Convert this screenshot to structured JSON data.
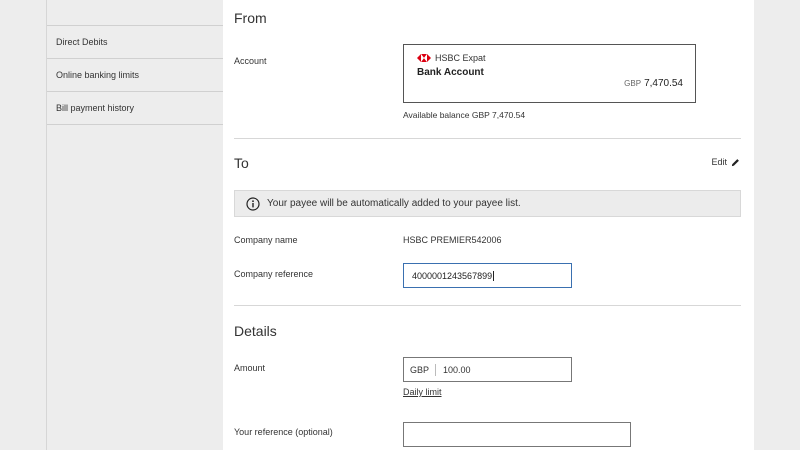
{
  "sidebar": {
    "items": [
      {
        "label": "Direct Debits"
      },
      {
        "label": "Online banking limits"
      },
      {
        "label": "Bill payment history"
      }
    ]
  },
  "from": {
    "title": "From",
    "account_label": "Account",
    "card": {
      "brand": "HSBC Expat",
      "account_name": "Bank Account",
      "currency": "GBP",
      "balance": "7,470.54"
    },
    "available": "Available balance GBP 7,470.54"
  },
  "to": {
    "title": "To",
    "edit_label": "Edit",
    "info_text": "Your payee will be automatically added to your payee list.",
    "company_name_label": "Company name",
    "company_name_value": "HSBC PREMIER542006",
    "company_ref_label": "Company reference",
    "company_ref_value": "4000001243567899"
  },
  "details": {
    "title": "Details",
    "amount_label": "Amount",
    "amount_currency": "GBP",
    "amount_value": "100.00",
    "daily_limit_link": "Daily limit",
    "your_ref_label": "Your reference (optional)",
    "your_ref_value": ""
  },
  "colors": {
    "brand_red": "#db0011",
    "focus_border": "#3a70b0"
  }
}
